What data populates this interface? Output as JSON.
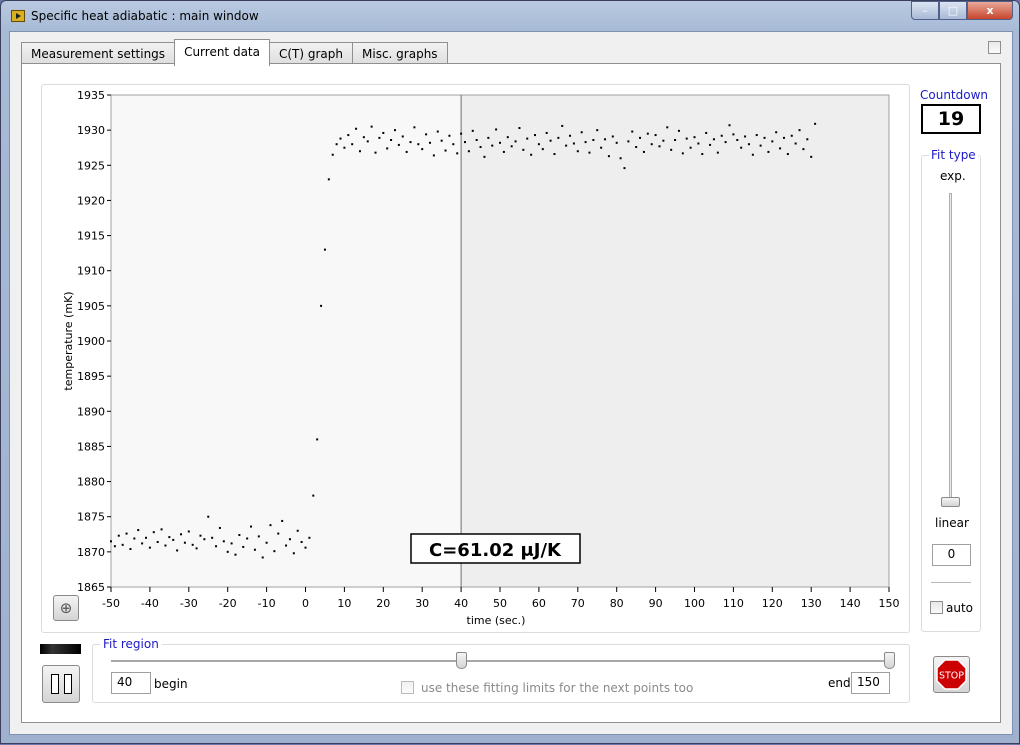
{
  "window": {
    "title": "Specific heat adiabatic : main window",
    "min": "–",
    "max": "□",
    "close": "x"
  },
  "tabs": [
    {
      "label": "Measurement settings"
    },
    {
      "label": "Current data",
      "active": true
    },
    {
      "label": "C(T) graph"
    },
    {
      "label": "Misc. graphs"
    }
  ],
  "countdown": {
    "label": "Countdown",
    "value": "19"
  },
  "fit_type": {
    "label": "Fit type",
    "top": "exp.",
    "bottom": "linear",
    "value": "0",
    "position": 0,
    "auto_label": "auto",
    "auto_checked": false
  },
  "fit_region": {
    "label": "Fit region",
    "begin_label": "begin",
    "begin": "40",
    "end_label": "end",
    "end": "150",
    "checkbox_label": "use these fitting limits for the next points too",
    "checked": false,
    "slider_min": -50,
    "slider_max": 150
  },
  "stop_label": "STOP",
  "colors": {
    "accent": "#1a1ac8",
    "stop": "#cc0000"
  },
  "chart_data": {
    "type": "scatter",
    "xlabel": "time (sec.)",
    "ylabel": "temperature (mK)",
    "xlim": [
      -50,
      150
    ],
    "ylim": [
      1865,
      1935
    ],
    "xticks": [
      "-50",
      "-40",
      "-30",
      "-20",
      "-10",
      "0",
      "10",
      "20",
      "30",
      "40",
      "50",
      "60",
      "70",
      "80",
      "90",
      "100",
      "110",
      "120",
      "130",
      "140",
      "150"
    ],
    "yticks": [
      "1865",
      "1870",
      "1875",
      "1880",
      "1885",
      "1890",
      "1895",
      "1900",
      "1905",
      "1910",
      "1915",
      "1920",
      "1925",
      "1930",
      "1935"
    ],
    "cursor_x": 40,
    "annotation": "C=61.02 μJ/K",
    "x_start": -50,
    "x_step": 1,
    "y": [
      1871.5,
      1870.8,
      1872.3,
      1871.0,
      1872.6,
      1870.4,
      1871.9,
      1873.1,
      1871.2,
      1872.0,
      1870.6,
      1872.8,
      1871.4,
      1873.2,
      1870.9,
      1872.1,
      1871.7,
      1870.2,
      1872.5,
      1871.3,
      1872.9,
      1871.0,
      1870.5,
      1872.3,
      1871.8,
      1875.0,
      1872.0,
      1870.8,
      1873.4,
      1871.5,
      1870.0,
      1871.2,
      1869.6,
      1872.4,
      1870.7,
      1871.9,
      1873.6,
      1870.3,
      1872.2,
      1869.2,
      1871.3,
      1873.8,
      1870.1,
      1872.6,
      1874.4,
      1870.9,
      1871.8,
      1869.8,
      1873.0,
      1871.4,
      1870.6,
      1872.0,
      1878.0,
      1886.0,
      1905.0,
      1913.0,
      1923.0,
      1926.5,
      1928.0,
      1928.8,
      1927.5,
      1929.3,
      1928.0,
      1930.2,
      1927.0,
      1929.0,
      1928.4,
      1930.5,
      1926.8,
      1928.9,
      1929.6,
      1927.4,
      1928.6,
      1930.0,
      1927.9,
      1929.1,
      1926.9,
      1928.3,
      1930.4,
      1928.0,
      1927.3,
      1929.4,
      1928.2,
      1926.4,
      1929.8,
      1928.5,
      1927.1,
      1929.2,
      1928.0,
      1926.7,
      1929.5,
      1928.3,
      1927.0,
      1929.9,
      1928.6,
      1927.6,
      1926.2,
      1928.9,
      1927.8,
      1930.1,
      1928.2,
      1926.9,
      1929.0,
      1927.7,
      1928.4,
      1930.3,
      1927.2,
      1928.8,
      1926.5,
      1929.3,
      1928.0,
      1927.3,
      1929.6,
      1928.5,
      1926.6,
      1928.9,
      1930.6,
      1927.8,
      1929.2,
      1928.1,
      1927.0,
      1929.7,
      1928.3,
      1926.8,
      1928.6,
      1930.0,
      1927.5,
      1928.7,
      1926.3,
      1929.1,
      1928.2,
      1926.0,
      1924.6,
      1928.4,
      1929.8,
      1927.6,
      1928.9,
      1926.9,
      1929.5,
      1928.0,
      1929.3,
      1927.7,
      1928.5,
      1930.4,
      1927.2,
      1928.6,
      1929.9,
      1926.7,
      1928.8,
      1927.5,
      1929.0,
      1928.1,
      1926.6,
      1929.6,
      1927.9,
      1928.7,
      1926.8,
      1929.2,
      1928.3,
      1930.7,
      1929.4,
      1928.6,
      1927.5,
      1929.1,
      1928.0,
      1926.5,
      1929.3,
      1927.8,
      1928.9,
      1926.9,
      1928.4,
      1929.7,
      1927.4,
      1928.9,
      1926.6,
      1929.2,
      1928.1,
      1930.0,
      1927.3,
      1928.7,
      1926.2,
      1930.9
    ]
  }
}
